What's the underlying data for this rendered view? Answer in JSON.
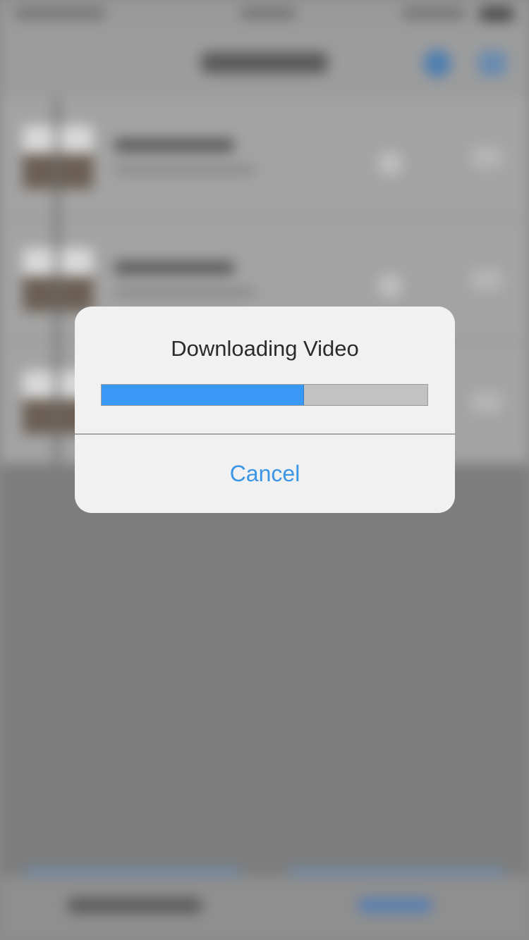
{
  "dialog": {
    "title": "Downloading Video",
    "progress": 0.62,
    "cancel_label": "Cancel"
  },
  "colors": {
    "progress_fill": "#3a98f6",
    "progress_track": "#c2c2c2",
    "cancel_text": "#3b96e6",
    "dialog_bg": "#f1f1f1"
  }
}
